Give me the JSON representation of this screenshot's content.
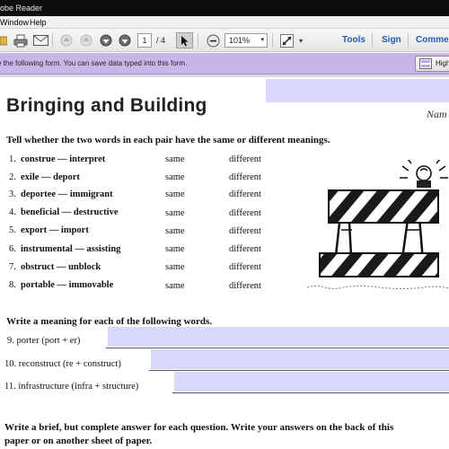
{
  "window": {
    "title": "obe Reader"
  },
  "menu": {
    "items": [
      "Window",
      "Help"
    ]
  },
  "toolbar": {
    "page_current": "1",
    "page_total": "/ 4",
    "zoom": "101%",
    "tools_label": "Tools",
    "sign_label": "Sign",
    "comment_label": "Comme"
  },
  "form_notice": {
    "text": "e the following form. You can save data typed into this form.",
    "highlight_label": "High"
  },
  "worksheet": {
    "title": "Bringing and Building",
    "name_label": "Nam",
    "section1_instruction": "Tell whether the two words in each pair have the same or different meanings.",
    "pairs": [
      {
        "num": "1.",
        "text": "construe  —  interpret",
        "same": "same",
        "different": "different"
      },
      {
        "num": "2.",
        "text": "exile  —  deport",
        "same": "same",
        "different": "different"
      },
      {
        "num": "3.",
        "text": "deportee  —  immigrant",
        "same": "same",
        "different": "different"
      },
      {
        "num": "4.",
        "text": "beneficial  —  destructive",
        "same": "same",
        "different": "different"
      },
      {
        "num": "5.",
        "text": "export  —  import",
        "same": "same",
        "different": "different"
      },
      {
        "num": "6.",
        "text": "instrumental  —  assisting",
        "same": "same",
        "different": "different"
      },
      {
        "num": "7.",
        "text": "obstruct  —  unblock",
        "same": "same",
        "different": "different"
      },
      {
        "num": "8.",
        "text": "portable  —  immovable",
        "same": "same",
        "different": "different"
      }
    ],
    "section2_instruction": "Write a meaning for each of the following words.",
    "meanings": [
      {
        "label": "9.  porter (port + er)"
      },
      {
        "label": "10. reconstruct (re + construct)"
      },
      {
        "label": "11. infrastructure (infra + structure)"
      }
    ],
    "section3_instruction_line1": "Write a brief, but complete answer for each question. Write your answers on the back of this",
    "section3_instruction_line2": "paper or on another sheet of paper."
  },
  "colors": {
    "form_bar": "#c9b6e9",
    "form_field": "#d8d9fa",
    "link_blue": "#1e5ea8"
  }
}
